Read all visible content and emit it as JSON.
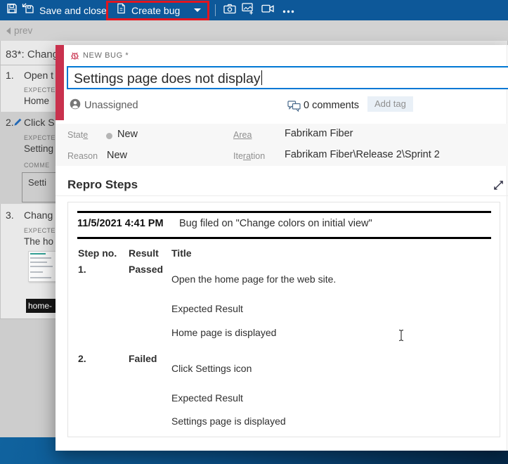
{
  "toolbar": {
    "save_and_close_label": "Save and close",
    "create_bug_label": "Create bug"
  },
  "nav": {
    "prev_label": "prev"
  },
  "test_panel": {
    "title": "83*: Chang",
    "steps": {
      "s1": {
        "no": "1.",
        "action": "Open t",
        "expected_label": "EXPECTE",
        "expected_text": "Home"
      },
      "s2": {
        "no": "2.",
        "action": "Click S",
        "expected_label": "EXPECTE",
        "expected_text": "Setting",
        "comment_label": "COMME",
        "comment_text": "Setti"
      },
      "s3": {
        "no": "3.",
        "action": "Chang",
        "expected_label": "EXPECTE",
        "expected_text": "The ho",
        "attachment_label": "home-"
      }
    }
  },
  "dialog": {
    "kicker": "NEW BUG *",
    "title_value": "Settings page does not display",
    "assignee": "Unassigned",
    "comments_label": "0 comments",
    "add_tag_label": "Add tag",
    "fields": {
      "state": {
        "label_pre": "Stat",
        "label_key": "e",
        "label_post": "",
        "value": "New"
      },
      "reason": {
        "label_pre": "Reason",
        "label_key": "",
        "label_post": "",
        "value": "New"
      },
      "area": {
        "label_pre": "",
        "label_key": "Area",
        "label_post": "",
        "value": "Fabrikam Fiber"
      },
      "iteration": {
        "label_pre": "Ite",
        "label_key": "ra",
        "label_post": "tion",
        "value": "Fabrikam Fiber\\Release 2\\Sprint 2"
      }
    },
    "repro": {
      "heading": "Repro Steps",
      "filed_time": "11/5/2021 4:41 PM",
      "filed_text": "Bug filed on \"Change colors on initial view\"",
      "columns": {
        "step": "Step no.",
        "result": "Result",
        "title": "Title"
      },
      "rows": [
        {
          "no": "1.",
          "result": "Passed",
          "title": "Open the home page for the web site.",
          "expected_label": "Expected Result",
          "expected": "Home page is displayed"
        },
        {
          "no": "2.",
          "result": "Failed",
          "title": "Click Settings icon",
          "expected_label": "Expected Result",
          "expected": "Settings page is displayed"
        }
      ]
    }
  },
  "colors": {
    "toolbar_blue": "#0d5899",
    "highlight_red": "#e1151f",
    "stripe_red": "#c9314d",
    "accent_blue": "#0078d4",
    "passed_green": "#107c10",
    "failed_red": "#e81123"
  }
}
